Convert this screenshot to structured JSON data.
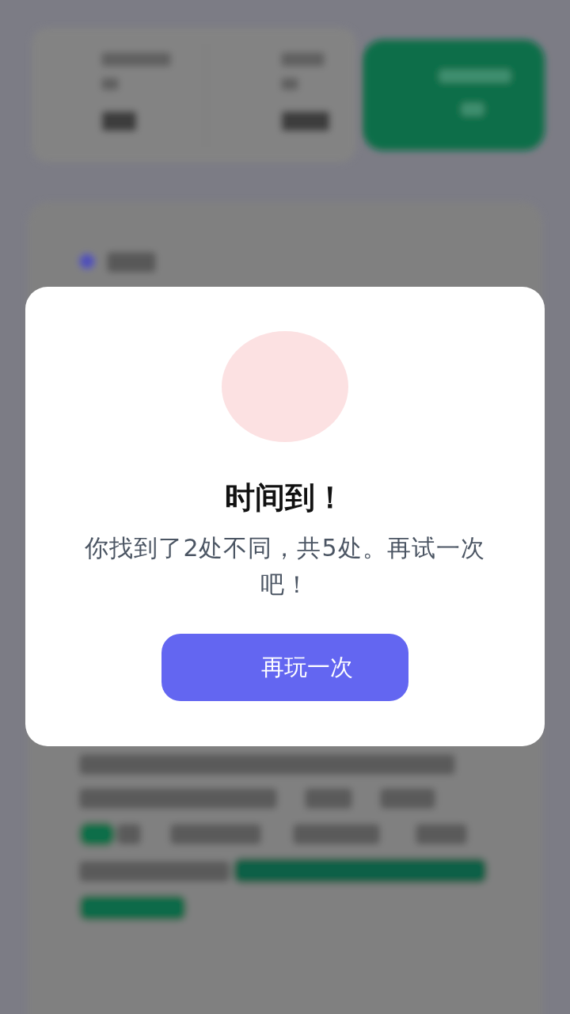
{
  "dialog": {
    "title": "时间到！",
    "message": "你找到了2处不同，共5处。再试一次吧！",
    "button": "再玩一次"
  }
}
